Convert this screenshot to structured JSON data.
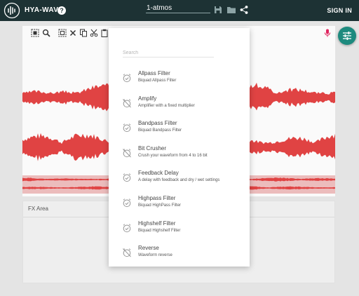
{
  "app": {
    "name": "HYA-WAVE",
    "help_label": "?"
  },
  "header": {
    "project_name": "1-atmos",
    "sign_in_label": "SIGN IN"
  },
  "fx_area": {
    "title": "FX Area"
  },
  "effects_menu": {
    "search_placeholder": "Search",
    "items": [
      {
        "name": "Allpass Filter",
        "description": "Biquad Allpass Filter",
        "icon": "alarm-check-icon"
      },
      {
        "name": "Amplify",
        "description": "Amplifier with a fixed multiplier",
        "icon": "alarm-off-icon"
      },
      {
        "name": "Bandpass Filter",
        "description": "Biquad Bandpass Filter",
        "icon": "alarm-check-icon"
      },
      {
        "name": "Bit Crusher",
        "description": "Crush your waveform from 4 to 16 bit",
        "icon": "alarm-off-icon"
      },
      {
        "name": "Feedback Delay",
        "description": "A delay with feedback and dry / wet settings",
        "icon": "alarm-check-icon"
      },
      {
        "name": "Highpass Filter",
        "description": "Biquad HighPass Filter",
        "icon": "alarm-check-icon"
      },
      {
        "name": "Highshelf Filter",
        "description": "Biquad Highshelf Filter",
        "icon": "alarm-check-icon"
      },
      {
        "name": "Reverse",
        "description": "Waveform reverse",
        "icon": "alarm-off-icon"
      }
    ]
  },
  "colors": {
    "appbar": "#1d3234",
    "accent": "#1d8a7e",
    "waveform": "#e04343",
    "mic": "#e0245e"
  }
}
